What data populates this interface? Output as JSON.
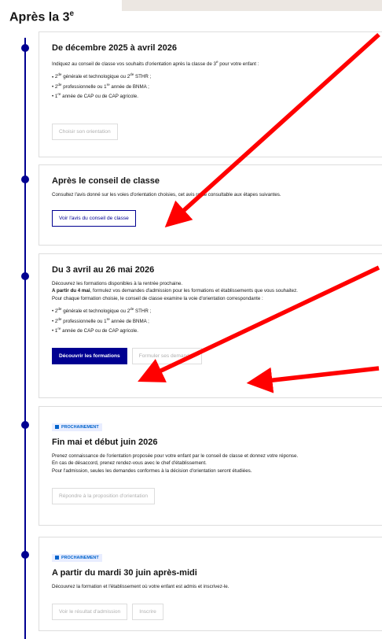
{
  "page_title": "Après la 3",
  "page_title_sup": "e",
  "colors": {
    "accent": "#000091",
    "badge_text": "#0063cb",
    "badge_bg": "#e8edff",
    "arrow": "#ff0000"
  },
  "step1": {
    "title": "De décembre 2025 à avril 2026",
    "intro_a": "Indiquez au conseil de classe vos souhaits d'orientation après la classe de 3",
    "intro_sup": "e",
    "intro_b": " pour votre enfant :",
    "options": [
      {
        "a": "2",
        "sa": "de",
        "b": " générale et technologique ou 2",
        "sb": "de",
        "c": " STHR ;"
      },
      {
        "a": "2",
        "sa": "de",
        "b": " professionnelle ou 1",
        "sb": "re",
        "c": " année de BNMA ;"
      },
      {
        "a": "1",
        "sa": "re",
        "b": " année de CAP ou de CAP agricole.",
        "sb": "",
        "c": ""
      }
    ],
    "button": "Choisir son orientation"
  },
  "step2": {
    "title": "Après le conseil de classe",
    "text": "Consultez l'avis donné sur les voies d'orientation choisies, cet avis reste consultable aux étapes suivantes.",
    "button": "Voir l'avis du conseil de classe"
  },
  "step3": {
    "title": "Du 3 avril au 26 mai 2026",
    "line1": "Découvrez les formations disponibles à la rentrée prochaine.",
    "line2_bold": "A partir du 4 mai",
    "line2_rest": ", formulez vos demandes d'admission pour les formations et établissements que vous souhaitez.",
    "line3": "Pour chaque formation choisie, le conseil de classe examine la voie d'orientation correspondante :",
    "options": [
      {
        "a": "2",
        "sa": "de",
        "b": " générale et technologique ou 2",
        "sb": "de",
        "c": " STHR ;"
      },
      {
        "a": "2",
        "sa": "de",
        "b": " professionnelle ou 1",
        "sb": "re",
        "c": " année de BNMA ;"
      },
      {
        "a": "1",
        "sa": "re",
        "b": " année de CAP ou de CAP agricole.",
        "sb": "",
        "c": ""
      }
    ],
    "button_primary": "Découvrir les formations",
    "button_secondary": "Formuler ses demandes"
  },
  "step4": {
    "badge": "PROCHAINEMENT",
    "title": "Fin mai et début juin 2026",
    "lines": [
      "Prenez connaissance de l'orientation proposée pour votre enfant par le conseil de classe et donnez votre réponse.",
      "En cas de désaccord, prenez rendez-vous avec le chef d'établissement.",
      "Pour l'admission, seules les demandes conformes à la décision d'orientation seront étudiées."
    ],
    "button": "Répondre à la proposition d'orientation"
  },
  "step5": {
    "badge": "PROCHAINEMENT",
    "title": "A partir du mardi 30 juin après-midi",
    "text": "Découvrez la formation et l'établissement où votre enfant est admis et inscrivez-le.",
    "button1": "Voir le résultat d'admission",
    "button2": "Inscrire"
  }
}
